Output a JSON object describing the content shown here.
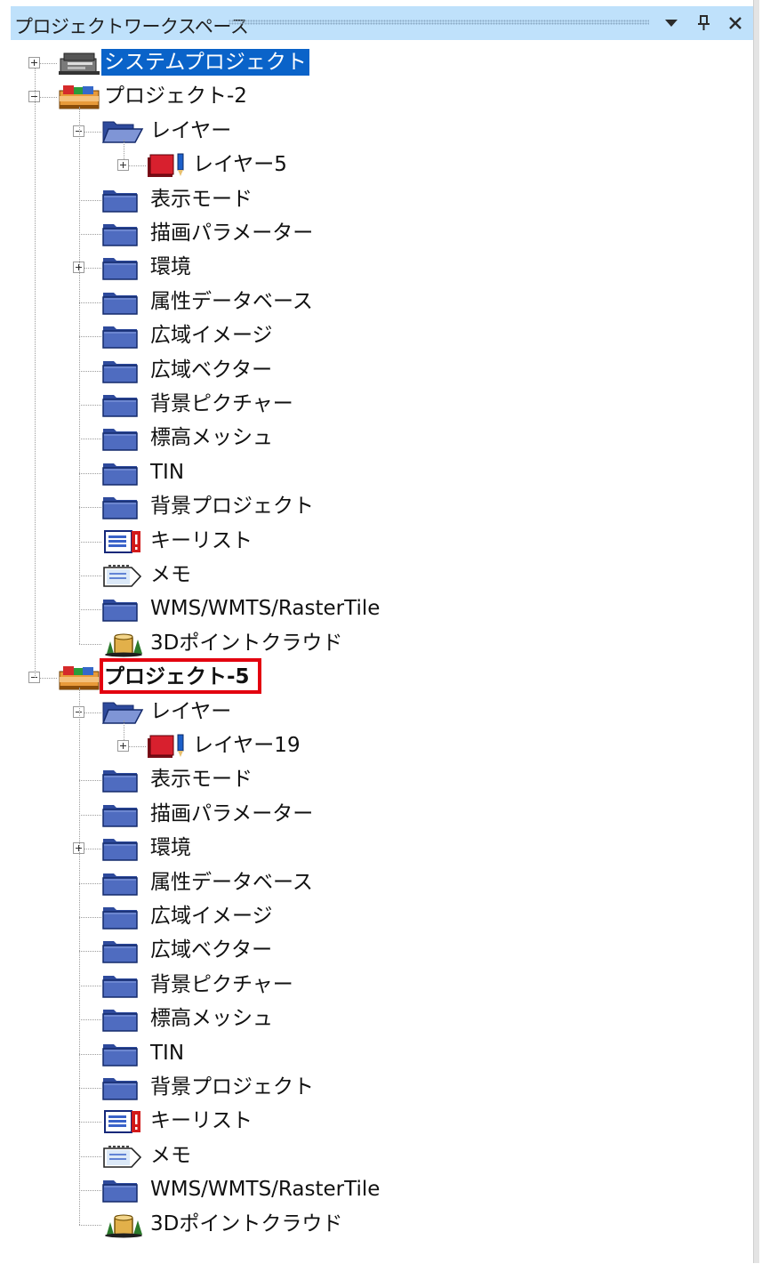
{
  "panel": {
    "title": "プロジェクトワークスペース"
  },
  "colors": {
    "titlebar_bg": "#bfe1fb",
    "selection": "#0a63c9",
    "highlight_box": "#e3000f",
    "folder": "#3f59a7"
  },
  "tree": {
    "root_system": "システムプロジェクト",
    "projects": [
      {
        "name": "プロジェクト-2",
        "layer_folder": "レイヤー",
        "layer_child": "レイヤー5",
        "items": [
          "表示モード",
          "描画パラメーター",
          "環境",
          "属性データベース",
          "広域イメージ",
          "広域ベクター",
          "背景ピクチャー",
          "標高メッシュ",
          "TIN",
          "背景プロジェクト",
          "キーリスト",
          "メモ",
          "WMS/WMTS/RasterTile",
          "3Dポイントクラウド"
        ]
      },
      {
        "name": "プロジェクト-5",
        "layer_folder": "レイヤー",
        "layer_child": "レイヤー19",
        "items": [
          "表示モード",
          "描画パラメーター",
          "環境",
          "属性データベース",
          "広域イメージ",
          "広域ベクター",
          "背景ピクチャー",
          "標高メッシュ",
          "TIN",
          "背景プロジェクト",
          "キーリスト",
          "メモ",
          "WMS/WMTS/RasterTile",
          "3Dポイントクラウド"
        ]
      }
    ]
  },
  "icons": {
    "titlebar": [
      "dropdown-arrow-icon",
      "pin-icon",
      "close-icon"
    ],
    "item_icons": [
      "folder-icon",
      "folder-icon",
      "folder-icon",
      "folder-icon",
      "folder-icon",
      "folder-icon",
      "folder-icon",
      "folder-icon",
      "folder-icon",
      "folder-icon",
      "key-list-icon",
      "memo-icon",
      "folder-icon",
      "point-cloud-icon"
    ]
  }
}
